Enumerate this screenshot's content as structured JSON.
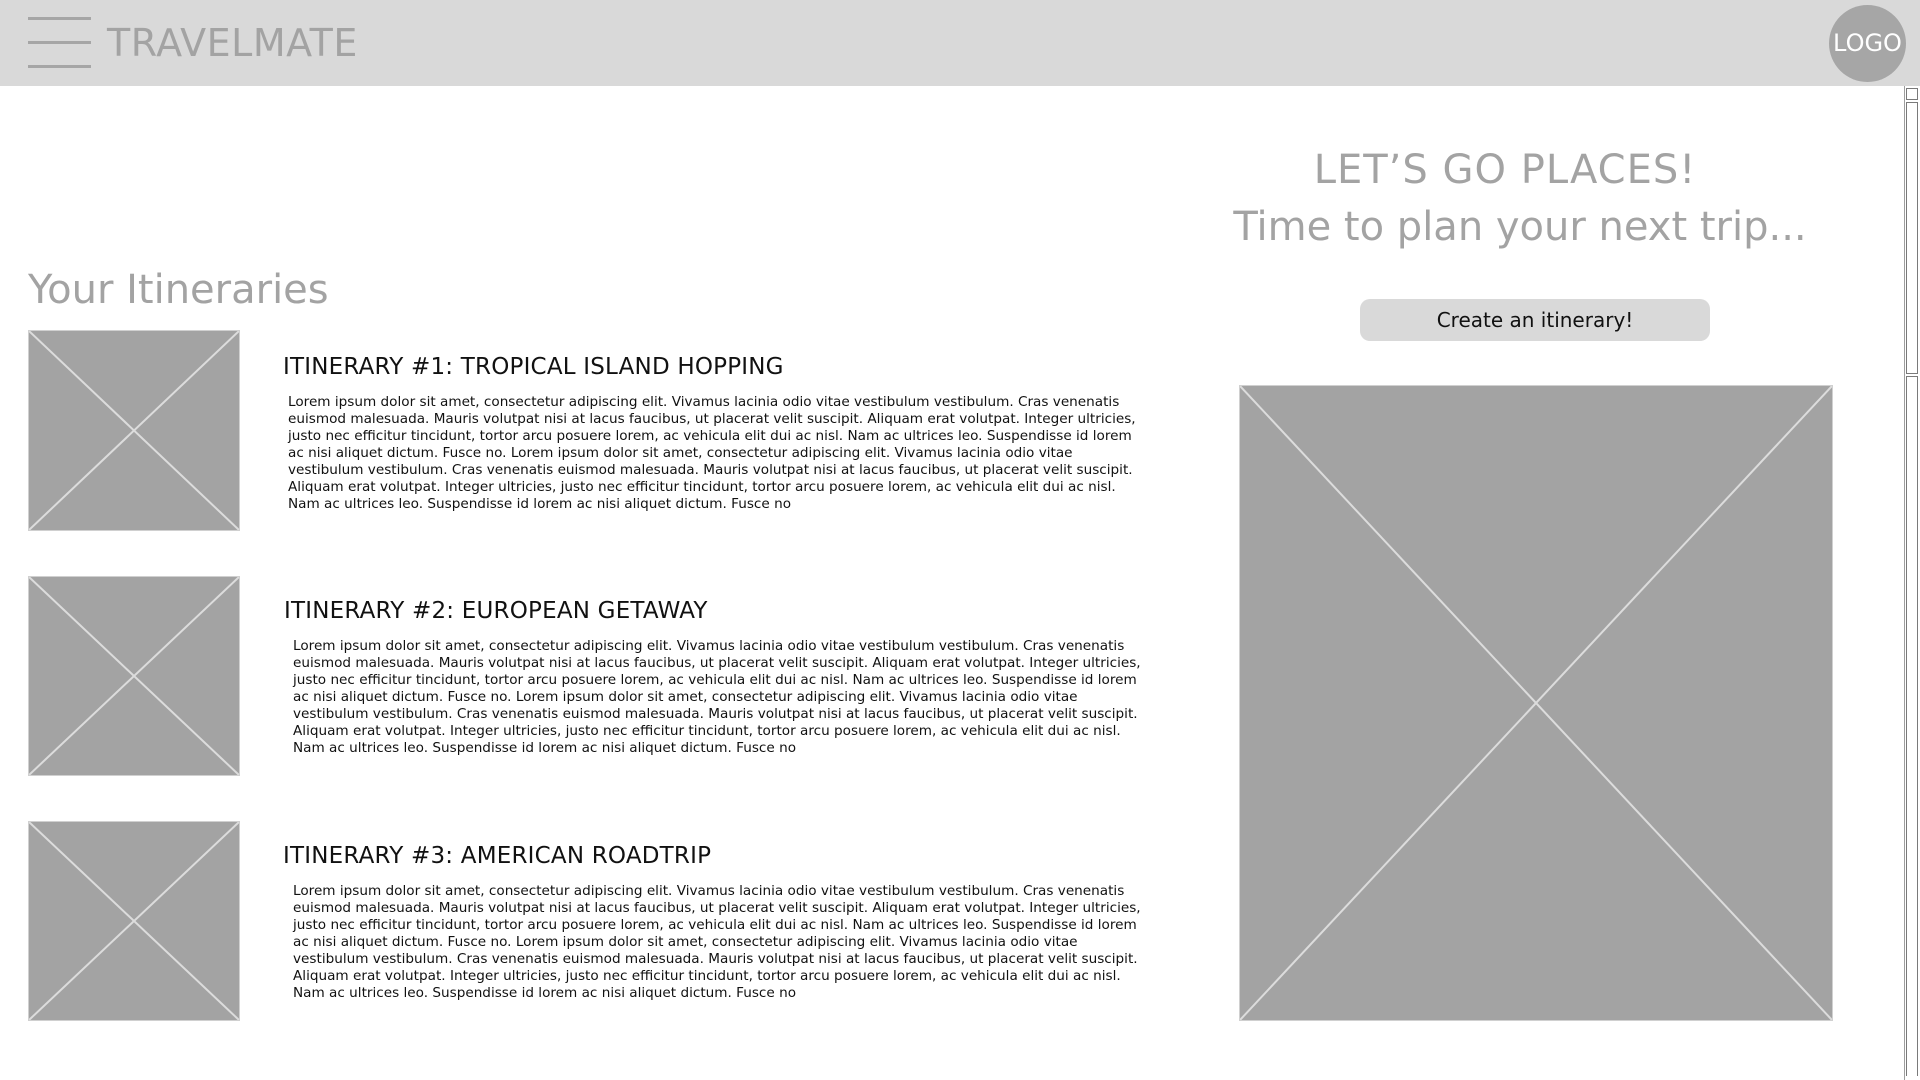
{
  "header": {
    "brand": "TRAVELMATE",
    "logo_label": "LOGO",
    "menu_icon": "hamburger-menu-icon"
  },
  "main": {
    "section_title": "Your Itineraries",
    "itineraries": [
      {
        "title": "ITINERARY #1: TROPICAL ISLAND HOPPING",
        "description": "Lorem ipsum dolor sit amet, consectetur adipiscing elit. Vivamus lacinia odio vitae vestibulum vestibulum. Cras venenatis euismod malesuada. Mauris volutpat nisi at lacus faucibus, ut placerat velit suscipit. Aliquam erat volutpat. Integer ultricies, justo nec efficitur tincidunt, tortor arcu posuere lorem, ac vehicula elit dui ac nisl. Nam ac ultrices leo. Suspendisse id lorem ac nisi aliquet dictum. Fusce no. Lorem ipsum dolor sit amet, consectetur adipiscing elit. Vivamus lacinia odio vitae vestibulum vestibulum. Cras venenatis euismod malesuada. Mauris volutpat nisi at lacus faucibus, ut placerat velit suscipit. Aliquam erat volutpat. Integer ultricies, justo nec efficitur tincidunt, tortor arcu posuere lorem, ac vehicula elit dui ac nisl. Nam ac ultrices leo. Suspendisse id lorem ac nisi aliquet dictum. Fusce no"
      },
      {
        "title": "ITINERARY #2: EUROPEAN GETAWAY",
        "description": "Lorem ipsum dolor sit amet, consectetur adipiscing elit. Vivamus lacinia odio vitae vestibulum vestibulum. Cras venenatis euismod malesuada. Mauris volutpat nisi at lacus faucibus, ut placerat velit suscipit. Aliquam erat volutpat. Integer ultricies, justo nec efficitur tincidunt, tortor arcu posuere lorem, ac vehicula elit dui ac nisl. Nam ac ultrices leo. Suspendisse id lorem ac nisi aliquet dictum. Fusce no. Lorem ipsum dolor sit amet, consectetur adipiscing elit. Vivamus lacinia odio vitae vestibulum vestibulum. Cras venenatis euismod malesuada. Mauris volutpat nisi at lacus faucibus, ut placerat velit suscipit. Aliquam erat volutpat. Integer ultricies, justo nec efficitur tincidunt, tortor arcu posuere lorem, ac vehicula elit dui ac nisl. Nam ac ultrices leo. Suspendisse id lorem ac nisi aliquet dictum. Fusce no"
      },
      {
        "title": "ITINERARY #3: AMERICAN ROADTRIP",
        "description": "Lorem ipsum dolor sit amet, consectetur adipiscing elit. Vivamus lacinia odio vitae vestibulum vestibulum. Cras venenatis euismod malesuada. Mauris volutpat nisi at lacus faucibus, ut placerat velit suscipit. Aliquam erat volutpat. Integer ultricies, justo nec efficitur tincidunt, tortor arcu posuere lorem, ac vehicula elit dui ac nisl. Nam ac ultrices leo. Suspendisse id lorem ac nisi aliquet dictum. Fusce no. Lorem ipsum dolor sit amet, consectetur adipiscing elit. Vivamus lacinia odio vitae vestibulum vestibulum. Cras venenatis euismod malesuada. Mauris volutpat nisi at lacus faucibus, ut placerat velit suscipit. Aliquam erat volutpat. Integer ultricies, justo nec efficitur tincidunt, tortor arcu posuere lorem, ac vehicula elit dui ac nisl. Nam ac ultrices leo. Suspendisse id lorem ac nisi aliquet dictum. Fusce no"
      }
    ]
  },
  "hero": {
    "title": "LET’S GO PLACES!",
    "subtitle": "Time to plan your next trip...",
    "cta_label": "Create an itinerary!"
  },
  "colors": {
    "header_bg": "#d9d9d9",
    "placeholder_gray": "#a3a3a3",
    "button_bg": "#d9d9d9",
    "text_dark": "#111111"
  }
}
